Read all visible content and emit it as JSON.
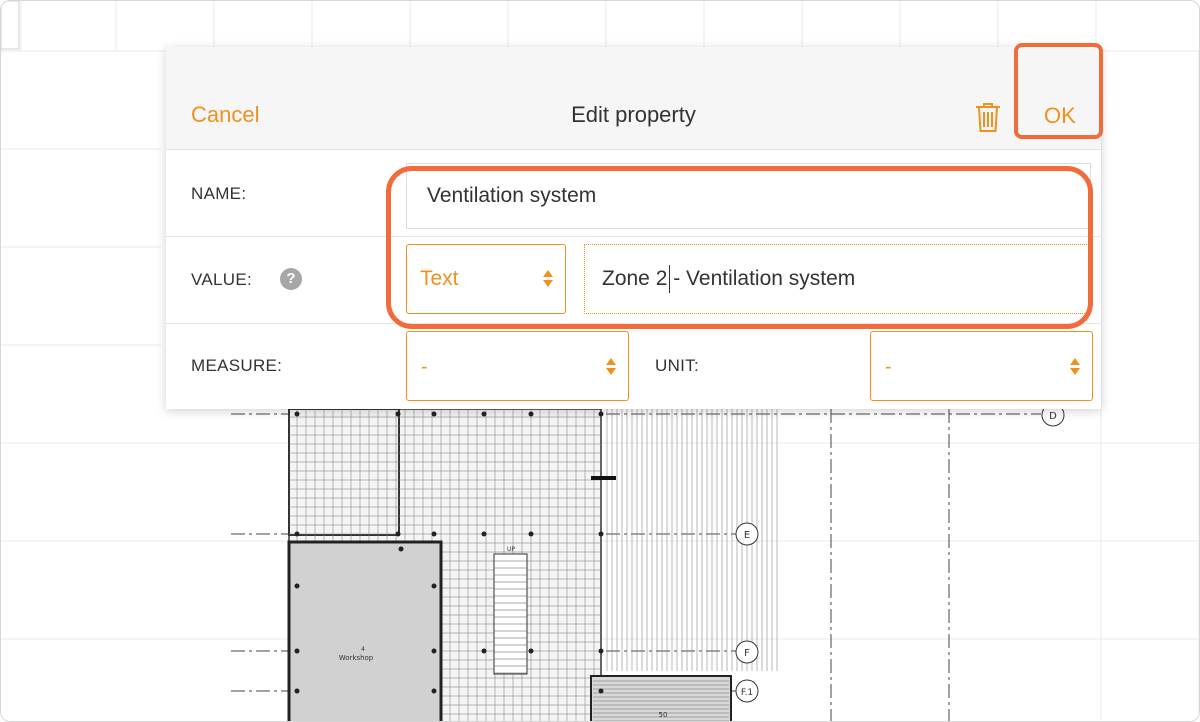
{
  "dialog": {
    "title": "Edit property",
    "cancel_label": "Cancel",
    "ok_label": "OK",
    "delete_icon": "trash-icon"
  },
  "form": {
    "name_label": "NAME:",
    "name_value": "Ventilation system",
    "value_label": "VALUE:",
    "help_icon": "?",
    "value_type": "Text",
    "value_text": "Zone 2 - Ventilation system",
    "measure_label": "MEASURE:",
    "measure_value": "-",
    "unit_label": "UNIT:",
    "unit_value": "-"
  },
  "floorplan": {
    "grid_markers": [
      "D",
      "E",
      "F",
      "F.1"
    ],
    "room_workshop_number": "4",
    "room_workshop": "Workshop",
    "room_number": "50",
    "stair_label": "UP"
  },
  "colors": {
    "accent": "#f0901e",
    "highlight": "#f26b3a"
  }
}
